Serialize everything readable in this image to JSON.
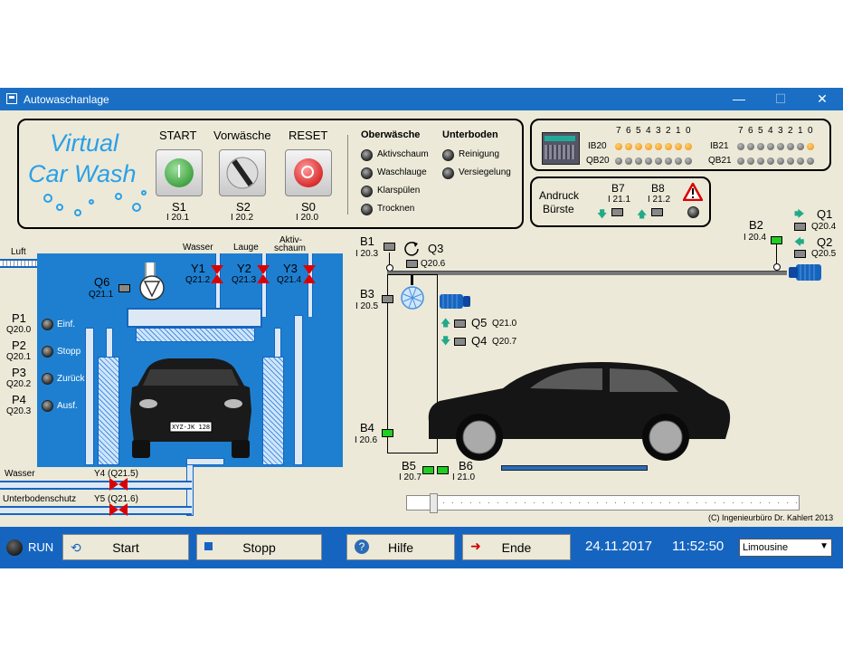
{
  "window": {
    "title": "Autowaschanlage"
  },
  "logo": {
    "line1": "Virtual",
    "line2": "Car Wash"
  },
  "buttons": [
    {
      "label": "START",
      "code": "S1",
      "addr": "I 20.1"
    },
    {
      "label": "Vorwäsche",
      "code": "S2",
      "addr": "I 20.2"
    },
    {
      "label": "RESET",
      "code": "S0",
      "addr": "I 20.0"
    }
  ],
  "programs": {
    "oberwaesche_title": "Oberwäsche",
    "unterboden_title": "Unterboden",
    "ober": [
      "Aktivschaum",
      "Waschlauge",
      "Klarspülen",
      "Trocknen"
    ],
    "unter": [
      "Reinigung",
      "Versiegelung"
    ]
  },
  "io": {
    "bits": [
      "7",
      "6",
      "5",
      "4",
      "3",
      "2",
      "1",
      "0"
    ],
    "IB20": "IB20",
    "QB20": "QB20",
    "IB21": "IB21",
    "QB21": "QB21",
    "ib20_on": [
      true,
      true,
      true,
      true,
      true,
      true,
      true,
      true
    ],
    "ib21_on": [
      false,
      false,
      false,
      false,
      false,
      false,
      false,
      true
    ]
  },
  "andruck": {
    "title1": "Andruck",
    "title2": "Bürste",
    "b7": "B7",
    "b7addr": "I 21.1",
    "b8": "B8",
    "b8addr": "I 21.2"
  },
  "labels": {
    "luft": "Luft",
    "wasser": "Wasser",
    "lauge": "Lauge",
    "aktiv1": "Aktiv-",
    "aktiv2": "schaum",
    "y1": "Y1",
    "y1a": "Q21.2",
    "y2": "Y2",
    "y2a": "Q21.3",
    "y3": "Y3",
    "y3a": "Q21.4",
    "q6": "Q6",
    "q6a": "Q21.1",
    "p1": "P1",
    "p1a": "Q20.0",
    "p1t": "Einf.",
    "p2": "P2",
    "p2a": "Q20.1",
    "p2t": "Stopp",
    "p3": "P3",
    "p3a": "Q20.2",
    "p3t": "Zurück",
    "p4": "P4",
    "p4a": "Q20.3",
    "p4t": "Ausf.",
    "wasser2": "Wasser",
    "unterboden": "Unterbodenschutz",
    "y4": "Y4 (Q21.5)",
    "y5": "Y5 (Q21.6)",
    "b1": "B1",
    "b1a": "I 20.3",
    "q3": "Q3",
    "q3a": "Q20.6",
    "b3": "B3",
    "b3a": "I 20.5",
    "q5": "Q5",
    "q5a": "Q21.0",
    "q4": "Q4",
    "q4a": "Q20.7",
    "b4": "B4",
    "b4a": "I 20.6",
    "b5": "B5",
    "b5a": "I 20.7",
    "b6": "B6",
    "b6a": "I 21.0",
    "b2": "B2",
    "b2a": "I 20.4",
    "q1": "Q1",
    "q1a": "Q20.4",
    "q2": "Q2",
    "q2a": "Q20.5",
    "plate": "XYZ-JK 128",
    "copyright": "(C) Ingenieurbüro Dr. Kahlert 2013"
  },
  "bottom": {
    "run": "RUN",
    "start": "Start",
    "stopp": "Stopp",
    "hilfe": "Hilfe",
    "ende": "Ende",
    "date": "24.11.2017",
    "time": "11:52:50",
    "select": "Limousine"
  }
}
